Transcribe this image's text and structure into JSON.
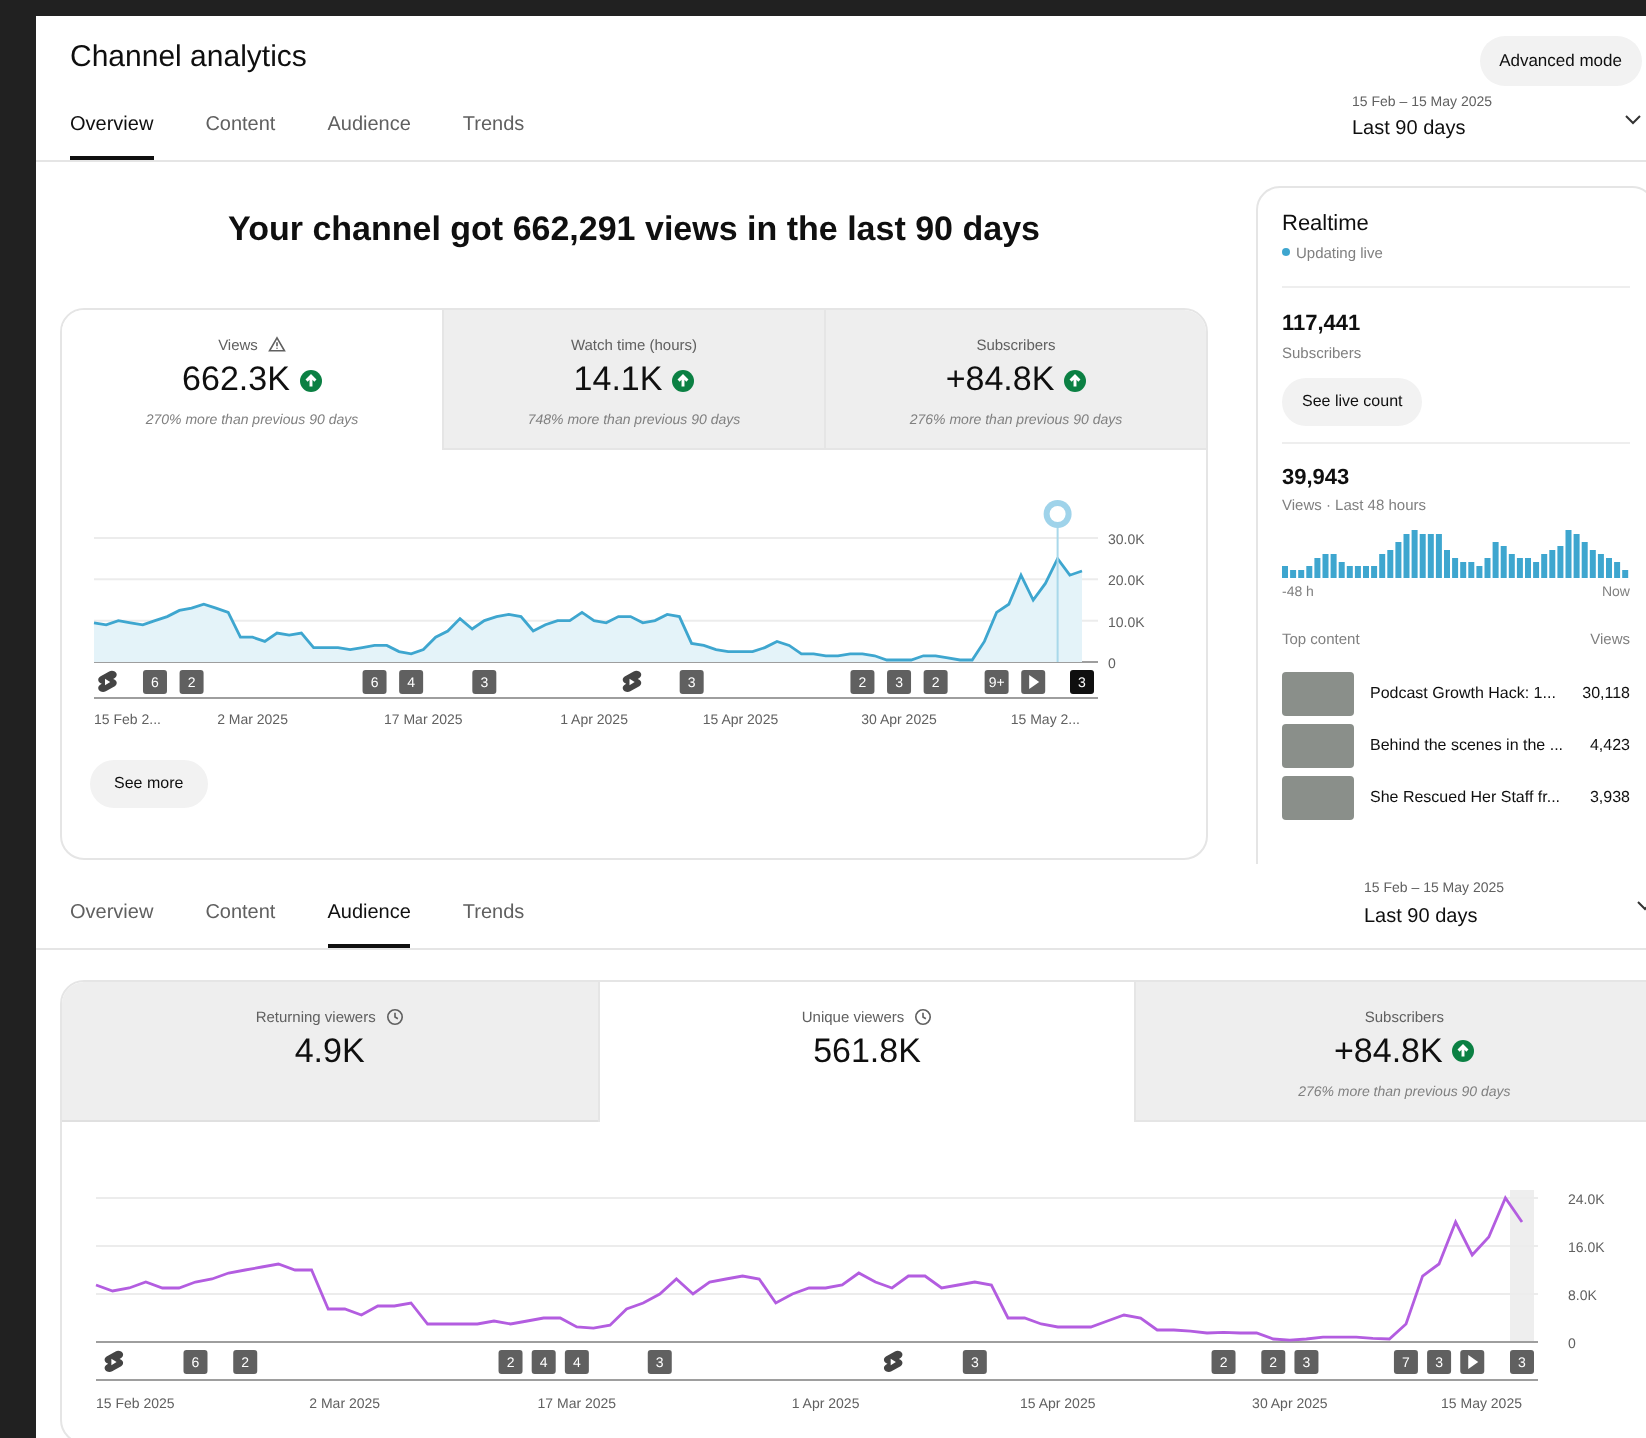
{
  "header": {
    "title": "Channel analytics",
    "advanced_mode": "Advanced mode"
  },
  "overview": {
    "tabs": [
      {
        "label": "Overview",
        "selected": true
      },
      {
        "label": "Content",
        "selected": false
      },
      {
        "label": "Audience",
        "selected": false
      },
      {
        "label": "Trends",
        "selected": false
      }
    ],
    "date_range": {
      "dates": "15 Feb – 15 May 2025",
      "label": "Last 90 days"
    },
    "headline": "Your channel got 662,291 views in the last 90 days",
    "metrics": [
      {
        "label": "Views",
        "warning": true,
        "clock": false,
        "value": "662.3K",
        "trend_up": true,
        "change": "270% more than previous 90 days",
        "selected": true
      },
      {
        "label": "Watch time (hours)",
        "warning": false,
        "clock": false,
        "value": "14.1K",
        "trend_up": true,
        "change": "748% more than previous 90 days",
        "selected": false
      },
      {
        "label": "Subscribers",
        "warning": false,
        "clock": false,
        "value": "+84.8K",
        "trend_up": true,
        "change": "276% more than previous 90 days",
        "selected": false
      }
    ],
    "chart": {
      "chart_data": {
        "type": "area",
        "series": [
          {
            "color": "#3ea6cf",
            "values": [
              9500,
              9000,
              10000,
              9500,
              9000,
              10000,
              11000,
              12500,
              13000,
              14000,
              13000,
              12000,
              6000,
              6000,
              5000,
              7000,
              6500,
              7000,
              3500,
              3500,
              3500,
              3000,
              3500,
              4000,
              4000,
              2500,
              2000,
              3000,
              6000,
              7500,
              10500,
              8000,
              10000,
              11000,
              11500,
              11000,
              7500,
              9000,
              10000,
              10000,
              12000,
              10000,
              9500,
              11000,
              11000,
              9500,
              10000,
              11500,
              11000,
              4500,
              4000,
              3000,
              2500,
              2500,
              2500,
              3500,
              5000,
              4000,
              2000,
              2000,
              1500,
              1500,
              2000,
              2000,
              1500,
              500,
              500,
              500,
              1500,
              1500,
              1000,
              500,
              500,
              5000,
              12000,
              14000,
              21000,
              15000,
              19000,
              25000,
              21000,
              22000
            ]
          }
        ],
        "ylim": [
          0,
          30000
        ],
        "yticks": [
          {
            "value": 0,
            "label": "0"
          },
          {
            "value": 10000,
            "label": "10.0K"
          },
          {
            "value": 20000,
            "label": "20.0K"
          },
          {
            "value": 30000,
            "label": "30.0K"
          }
        ]
      },
      "x_labels": [
        "15 Feb 2...",
        "2 Mar 2025",
        "17 Mar 2025",
        "1 Apr 2025",
        "15 Apr 2025",
        "30 Apr 2025",
        "15 May 2..."
      ],
      "markers": [
        {
          "kind": "shorts",
          "selected": false
        },
        {
          "kind": "number",
          "label": "6",
          "selected": false
        },
        {
          "kind": "number",
          "label": "2",
          "selected": false
        },
        {
          "kind": "number",
          "label": "6",
          "selected": false
        },
        {
          "kind": "number",
          "label": "4",
          "selected": false
        },
        {
          "kind": "number",
          "label": "3",
          "selected": false
        },
        {
          "kind": "shorts",
          "selected": false
        },
        {
          "kind": "number",
          "label": "3",
          "selected": false
        },
        {
          "kind": "number",
          "label": "2",
          "selected": false
        },
        {
          "kind": "number",
          "label": "3",
          "selected": false
        },
        {
          "kind": "number",
          "label": "2",
          "selected": false
        },
        {
          "kind": "number",
          "label": "9+",
          "selected": false
        },
        {
          "kind": "play",
          "selected": false
        },
        {
          "kind": "number",
          "label": "3",
          "selected": true
        }
      ]
    },
    "see_more": "See more"
  },
  "realtime": {
    "title": "Realtime",
    "status": "Updating live",
    "subscribers": "117,441",
    "subscribers_label": "Subscribers",
    "live_button": "See live count",
    "views": "39,943",
    "views_label": "Views · Last 48 hours",
    "axis_start": "-48 h",
    "axis_end": "Now",
    "top_content_label": "Top content",
    "views_column": "Views",
    "top_content": [
      {
        "title": "Podcast Growth Hack: 1...",
        "views": "30,118"
      },
      {
        "title": "Behind the scenes in the ...",
        "views": "4,423"
      },
      {
        "title": "She Rescued Her Staff fr...",
        "views": "3,938"
      }
    ]
  },
  "audience": {
    "tabs": [
      {
        "label": "Overview",
        "selected": false
      },
      {
        "label": "Content",
        "selected": false
      },
      {
        "label": "Audience",
        "selected": true
      },
      {
        "label": "Trends",
        "selected": false
      }
    ],
    "date_range": {
      "dates": "15 Feb – 15 May 2025",
      "label": "Last 90 days"
    },
    "metrics": [
      {
        "label": "Returning viewers",
        "warning": false,
        "clock": true,
        "value": "4.9K",
        "trend_up": false,
        "selected": false
      },
      {
        "label": "Unique viewers",
        "warning": false,
        "clock": true,
        "value": "561.8K",
        "trend_up": false,
        "selected": true
      },
      {
        "label": "Subscribers",
        "warning": false,
        "clock": false,
        "value": "+84.8K",
        "trend_up": true,
        "change": "276% more than previous 90 days",
        "selected": false
      }
    ],
    "chart": {
      "chart_data": {
        "type": "line",
        "series": [
          {
            "color": "#b35de0",
            "values": [
              9500,
              8500,
              9000,
              10000,
              9000,
              9000,
              10000,
              10500,
              11500,
              12000,
              12500,
              13000,
              12000,
              12000,
              5500,
              5500,
              4500,
              6000,
              6000,
              6500,
              3000,
              3000,
              3000,
              3000,
              3500,
              3000,
              3500,
              4000,
              4000,
              2500,
              2300,
              2800,
              5500,
              6500,
              8000,
              10500,
              8000,
              10000,
              10500,
              11000,
              10500,
              6500,
              8000,
              9000,
              9000,
              9500,
              11500,
              10000,
              9000,
              11000,
              11000,
              9000,
              9500,
              10000,
              9500,
              4000,
              4000,
              3000,
              2500,
              2500,
              2500,
              3500,
              4500,
              4000,
              2000,
              2000,
              1800,
              1500,
              1600,
              1500,
              1500,
              500,
              300,
              500,
              800,
              800,
              800,
              600,
              500,
              3000,
              11000,
              13000,
              20000,
              14500,
              17500,
              24000,
              20000
            ]
          }
        ],
        "ylim": [
          0,
          24000
        ],
        "yticks": [
          {
            "value": 0,
            "label": "0"
          },
          {
            "value": 8000,
            "label": "8.0K"
          },
          {
            "value": 16000,
            "label": "16.0K"
          },
          {
            "value": 24000,
            "label": "24.0K"
          }
        ]
      },
      "x_labels": [
        "15 Feb 2025",
        "2 Mar 2025",
        "17 Mar 2025",
        "1 Apr 2025",
        "15 Apr 2025",
        "30 Apr 2025",
        "15 May 2025"
      ],
      "markers": [
        {
          "kind": "shorts",
          "selected": false
        },
        {
          "kind": "number",
          "label": "6",
          "selected": false
        },
        {
          "kind": "number",
          "label": "2",
          "selected": false
        },
        {
          "kind": "number",
          "label": "2",
          "selected": false
        },
        {
          "kind": "number",
          "label": "4",
          "selected": false
        },
        {
          "kind": "number",
          "label": "4",
          "selected": false
        },
        {
          "kind": "number",
          "label": "3",
          "selected": false
        },
        {
          "kind": "shorts",
          "selected": false
        },
        {
          "kind": "number",
          "label": "3",
          "selected": false
        },
        {
          "kind": "number",
          "label": "2",
          "selected": false
        },
        {
          "kind": "number",
          "label": "2",
          "selected": false
        },
        {
          "kind": "number",
          "label": "3",
          "selected": false
        },
        {
          "kind": "number",
          "label": "7",
          "selected": false
        },
        {
          "kind": "number",
          "label": "3",
          "selected": false
        },
        {
          "kind": "play",
          "selected": false
        },
        {
          "kind": "number",
          "label": "3",
          "selected": false
        }
      ]
    }
  }
}
